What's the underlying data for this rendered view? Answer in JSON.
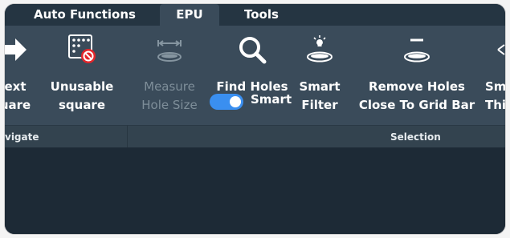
{
  "tabs": [
    {
      "label": "Auto Functions",
      "active": false
    },
    {
      "label": "EPU",
      "active": true
    },
    {
      "label": "Tools",
      "active": false
    }
  ],
  "ribbon": {
    "next_square": {
      "label_line1": "ext",
      "label_line2": "uare",
      "icon": "arrow-right-icon"
    },
    "unusable_square": {
      "label_line1": "Unusable",
      "label_line2": "square",
      "icon": "unusable-square-icon"
    },
    "measure_hole_size": {
      "label_line1": "Measure",
      "label_line2": "Hole Size",
      "icon": "measure-hole-icon",
      "disabled": true
    },
    "find_holes": {
      "label": "Find Holes",
      "icon": "magnifier-icon"
    },
    "smart_toggle": {
      "label": "Smart",
      "on": true
    },
    "smart_filter": {
      "label_line1": "Smart",
      "label_line2": "Filter",
      "icon": "smart-filter-icon"
    },
    "remove_holes": {
      "label_line1": "Remove Holes",
      "label_line2": "Close To Grid Bar",
      "icon": "remove-holes-icon"
    },
    "smart_thickness": {
      "label_line1": "Sm",
      "label_line2": "Thi",
      "icon": "thickness-icon"
    }
  },
  "groups": {
    "navigate": "vigate",
    "selection": "Selection"
  },
  "colors": {
    "ribbon_bg": "#3a4b5a",
    "workspace_bg": "#1d2a36",
    "toggle_on": "#3a8ff0",
    "prohibit_red": "#e3262b"
  }
}
